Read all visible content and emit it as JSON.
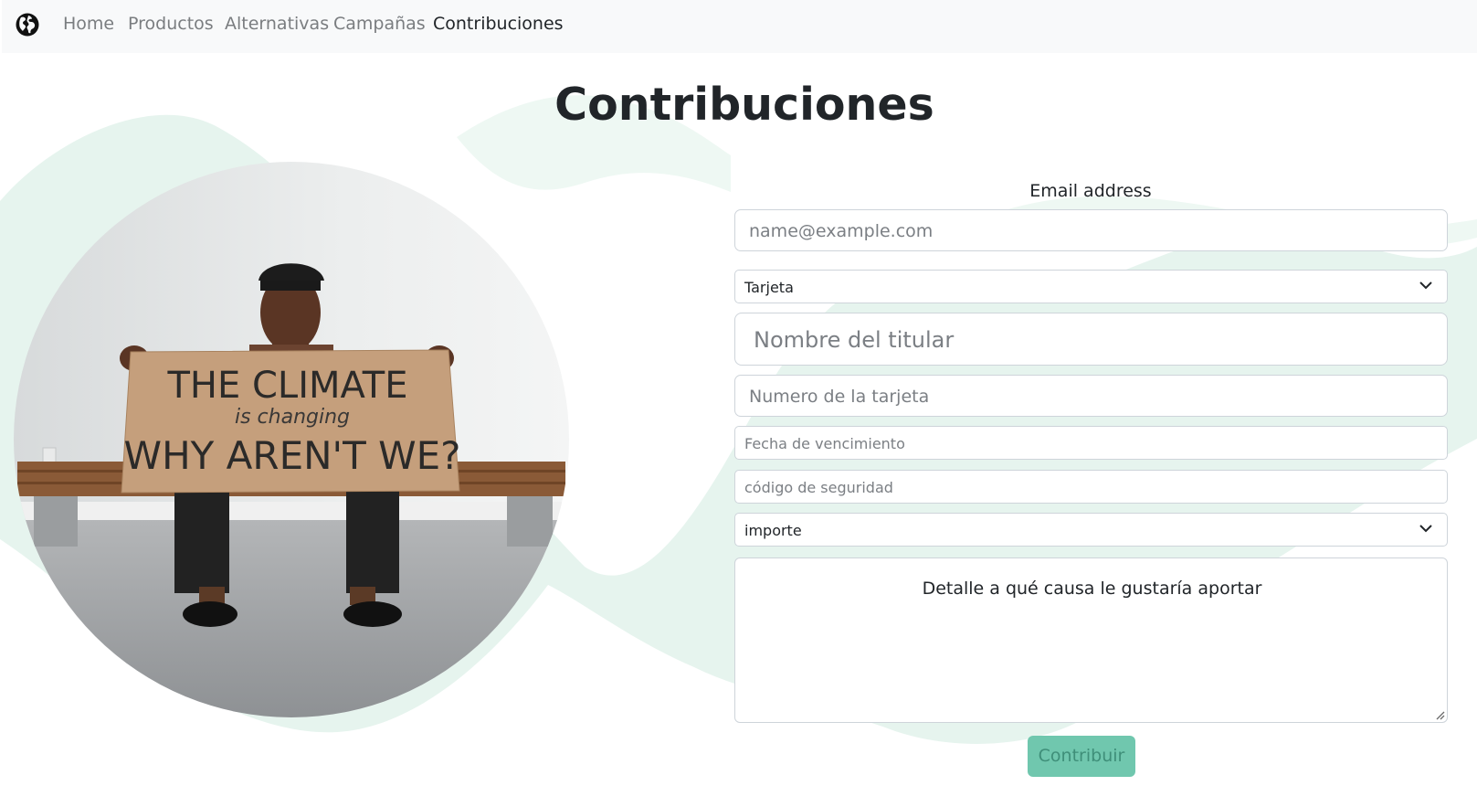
{
  "nav": {
    "brand_icon": "globe-icon",
    "links": [
      "Home",
      "Productos",
      "Alternativas",
      "Campañas",
      "Contribuciones"
    ],
    "active": "Contribuciones"
  },
  "page": {
    "title": "Contribuciones"
  },
  "photo": {
    "sign_line1": "THE CLIMATE",
    "sign_line2": "is changing",
    "sign_line3": "WHY AREN'T WE?"
  },
  "form": {
    "email_label": "Email address",
    "email_placeholder": "name@example.com",
    "payment_method": "Tarjeta",
    "holder_placeholder": "Nombre del titular",
    "card_number_placeholder": "Numero de la tarjeta",
    "expiry_placeholder": "Fecha de vencimiento",
    "security_code_placeholder": "código de seguridad",
    "amount_select": "importe",
    "detail_placeholder": "Detalle a qué causa le gustaría aportar",
    "submit_label": "Contribuir"
  },
  "colors": {
    "navbar_bg": "#f8f9fa",
    "wave": "#e6f4ee",
    "button": "#70c7ae",
    "button_text": "#3f8f79"
  }
}
